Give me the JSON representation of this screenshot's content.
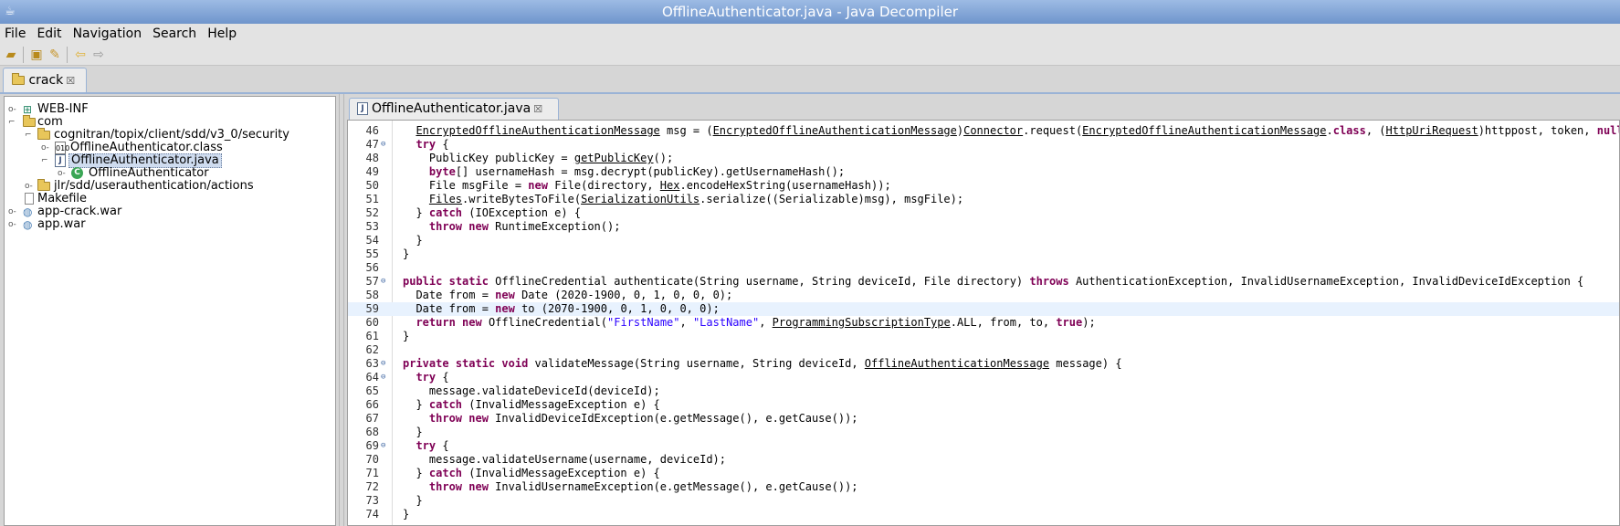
{
  "window": {
    "title": "OfflineAuthenticator.java - Java Decompiler"
  },
  "menu": [
    "File",
    "Edit",
    "Navigation",
    "Search",
    "Help"
  ],
  "toolbar": {
    "icons": [
      "open-file-icon",
      "open-type-icon",
      "search-icon",
      "back-arrow-icon",
      "forward-arrow-icon"
    ]
  },
  "main_tab": {
    "label": "crack"
  },
  "tree": [
    {
      "label": "WEB-INF",
      "icon": "package-icon",
      "expand": "collapsed"
    },
    {
      "label": "com",
      "icon": "folder-icon",
      "expand": "expanded"
    },
    {
      "label": "cognitran/topix/client/sdd/v3_0/security",
      "icon": "folder-icon",
      "expand": "expanded"
    },
    {
      "label": "OfflineAuthenticator.class",
      "icon": "class-file-icon",
      "expand": "collapsed"
    },
    {
      "label": "OfflineAuthenticator.java",
      "icon": "java-file-icon",
      "expand": "expanded",
      "selected": true
    },
    {
      "label": "OfflineAuthenticator",
      "icon": "class-icon",
      "expand": "collapsed"
    },
    {
      "label": "jlr/sdd/userauthentication/actions",
      "icon": "folder-icon",
      "expand": "collapsed"
    },
    {
      "label": "Makefile",
      "icon": "file-icon",
      "expand": "none"
    },
    {
      "label": "app-crack.war",
      "icon": "archive-icon",
      "expand": "collapsed"
    },
    {
      "label": "app.war",
      "icon": "archive-icon",
      "expand": "collapsed"
    }
  ],
  "editor_tab": {
    "label": "OfflineAuthenticator.java"
  },
  "code": [
    {
      "n": "46",
      "fold": false,
      "hl": false,
      "parts": [
        [
          "  ",
          ""
        ],
        [
          "EncryptedOfflineAuthenticationMessage",
          "ul"
        ],
        [
          " msg = (",
          ""
        ],
        [
          "EncryptedOfflineAuthenticationMessage",
          "ul"
        ],
        [
          ")",
          ""
        ],
        [
          "Connector",
          "ul"
        ],
        [
          ".request(",
          ""
        ],
        [
          "EncryptedOfflineAuthenticationMessage",
          "ul"
        ],
        [
          ".",
          ""
        ],
        [
          "class",
          "kw"
        ],
        [
          ", (",
          ""
        ],
        [
          "HttpUriRequest",
          "ul"
        ],
        [
          ")httppost, token, ",
          ""
        ],
        [
          "null",
          "kw"
        ],
        [
          ");",
          ""
        ]
      ]
    },
    {
      "n": "47",
      "fold": true,
      "hl": false,
      "parts": [
        [
          "  ",
          ""
        ],
        [
          "try",
          "kw"
        ],
        [
          " {",
          ""
        ]
      ]
    },
    {
      "n": "48",
      "fold": false,
      "hl": false,
      "parts": [
        [
          "    PublicKey publicKey = ",
          ""
        ],
        [
          "getPublicKey",
          "ul"
        ],
        [
          "();",
          ""
        ]
      ]
    },
    {
      "n": "49",
      "fold": false,
      "hl": false,
      "parts": [
        [
          "    ",
          ""
        ],
        [
          "byte",
          "kw"
        ],
        [
          "[] usernameHash = msg.decrypt(publicKey).getUsernameHash();",
          ""
        ]
      ]
    },
    {
      "n": "50",
      "fold": false,
      "hl": false,
      "parts": [
        [
          "    File msgFile = ",
          ""
        ],
        [
          "new",
          "kw"
        ],
        [
          " File(directory, ",
          ""
        ],
        [
          "Hex",
          "ul"
        ],
        [
          ".encodeHexString(usernameHash));",
          ""
        ]
      ]
    },
    {
      "n": "51",
      "fold": false,
      "hl": false,
      "parts": [
        [
          "    ",
          ""
        ],
        [
          "Files",
          "ul"
        ],
        [
          ".writeBytesToFile(",
          ""
        ],
        [
          "SerializationUtils",
          "ul"
        ],
        [
          ".serialize((Serializable)msg), msgFile);",
          ""
        ]
      ]
    },
    {
      "n": "52",
      "fold": false,
      "hl": false,
      "parts": [
        [
          "  } ",
          ""
        ],
        [
          "catch",
          "kw"
        ],
        [
          " (IOException e) {",
          ""
        ]
      ]
    },
    {
      "n": "53",
      "fold": false,
      "hl": false,
      "parts": [
        [
          "    ",
          ""
        ],
        [
          "throw",
          "kw"
        ],
        [
          " ",
          ""
        ],
        [
          "new",
          "kw"
        ],
        [
          " RuntimeException();",
          ""
        ]
      ]
    },
    {
      "n": "54",
      "fold": false,
      "hl": false,
      "parts": [
        [
          "  }",
          ""
        ]
      ]
    },
    {
      "n": "55",
      "fold": false,
      "hl": false,
      "parts": [
        [
          "}",
          ""
        ]
      ]
    },
    {
      "n": "56",
      "fold": false,
      "hl": false,
      "parts": []
    },
    {
      "n": "57",
      "fold": true,
      "hl": false,
      "parts": [
        [
          "",
          ""
        ],
        [
          "public",
          "kw"
        ],
        [
          " ",
          ""
        ],
        [
          "static",
          "kw"
        ],
        [
          " OfflineCredential authenticate(String username, String deviceId, File directory) ",
          ""
        ],
        [
          "throws",
          "kw"
        ],
        [
          " AuthenticationException, InvalidUsernameException, InvalidDeviceIdException {",
          ""
        ]
      ]
    },
    {
      "n": "58",
      "fold": false,
      "hl": false,
      "parts": [
        [
          "  Date from = ",
          ""
        ],
        [
          "new",
          "kw"
        ],
        [
          " Date (2020-1900, 0, 1, 0, 0, 0);",
          ""
        ]
      ]
    },
    {
      "n": "59",
      "fold": false,
      "hl": true,
      "parts": [
        [
          "  Date from = ",
          ""
        ],
        [
          "new",
          "kw"
        ],
        [
          " to (2070-1900, 0, 1, 0, 0, 0);",
          ""
        ]
      ]
    },
    {
      "n": "60",
      "fold": false,
      "hl": false,
      "parts": [
        [
          "  ",
          ""
        ],
        [
          "return",
          "kw"
        ],
        [
          " ",
          ""
        ],
        [
          "new",
          "kw"
        ],
        [
          " OfflineCredential(",
          ""
        ],
        [
          "\"FirstName\"",
          "str"
        ],
        [
          ", ",
          ""
        ],
        [
          "\"LastName\"",
          "str"
        ],
        [
          ", ",
          ""
        ],
        [
          "ProgrammingSubscriptionType",
          "ul"
        ],
        [
          ".ALL, from, to, ",
          ""
        ],
        [
          "true",
          "kw"
        ],
        [
          ");",
          ""
        ]
      ]
    },
    {
      "n": "61",
      "fold": false,
      "hl": false,
      "parts": [
        [
          "}",
          ""
        ]
      ]
    },
    {
      "n": "62",
      "fold": false,
      "hl": false,
      "parts": []
    },
    {
      "n": "63",
      "fold": true,
      "hl": false,
      "parts": [
        [
          "",
          ""
        ],
        [
          "private",
          "kw"
        ],
        [
          " ",
          ""
        ],
        [
          "static",
          "kw"
        ],
        [
          " ",
          ""
        ],
        [
          "void",
          "kw"
        ],
        [
          " validateMessage(String username, String deviceId, ",
          ""
        ],
        [
          "OfflineAuthenticationMessage",
          "ul"
        ],
        [
          " message) {",
          ""
        ]
      ]
    },
    {
      "n": "64",
      "fold": true,
      "hl": false,
      "parts": [
        [
          "  ",
          ""
        ],
        [
          "try",
          "kw"
        ],
        [
          " {",
          ""
        ]
      ]
    },
    {
      "n": "65",
      "fold": false,
      "hl": false,
      "parts": [
        [
          "    message.validateDeviceId(deviceId);",
          ""
        ]
      ]
    },
    {
      "n": "66",
      "fold": false,
      "hl": false,
      "parts": [
        [
          "  } ",
          ""
        ],
        [
          "catch",
          "kw"
        ],
        [
          " (InvalidMessageException e) {",
          ""
        ]
      ]
    },
    {
      "n": "67",
      "fold": false,
      "hl": false,
      "parts": [
        [
          "    ",
          ""
        ],
        [
          "throw",
          "kw"
        ],
        [
          " ",
          ""
        ],
        [
          "new",
          "kw"
        ],
        [
          " InvalidDeviceIdException(e.getMessage(), e.getCause());",
          ""
        ]
      ]
    },
    {
      "n": "68",
      "fold": false,
      "hl": false,
      "parts": [
        [
          "  }",
          ""
        ]
      ]
    },
    {
      "n": "69",
      "fold": true,
      "hl": false,
      "parts": [
        [
          "  ",
          ""
        ],
        [
          "try",
          "kw"
        ],
        [
          " {",
          ""
        ]
      ]
    },
    {
      "n": "70",
      "fold": false,
      "hl": false,
      "parts": [
        [
          "    message.validateUsername(username, deviceId);",
          ""
        ]
      ]
    },
    {
      "n": "71",
      "fold": false,
      "hl": false,
      "parts": [
        [
          "  } ",
          ""
        ],
        [
          "catch",
          "kw"
        ],
        [
          " (InvalidMessageException e) {",
          ""
        ]
      ]
    },
    {
      "n": "72",
      "fold": false,
      "hl": false,
      "parts": [
        [
          "    ",
          ""
        ],
        [
          "throw",
          "kw"
        ],
        [
          " ",
          ""
        ],
        [
          "new",
          "kw"
        ],
        [
          " InvalidUsernameException(e.getMessage(), e.getCause());",
          ""
        ]
      ]
    },
    {
      "n": "73",
      "fold": false,
      "hl": false,
      "parts": [
        [
          "  }",
          ""
        ]
      ]
    },
    {
      "n": "74",
      "fold": false,
      "hl": false,
      "parts": [
        [
          "}",
          ""
        ]
      ]
    }
  ]
}
